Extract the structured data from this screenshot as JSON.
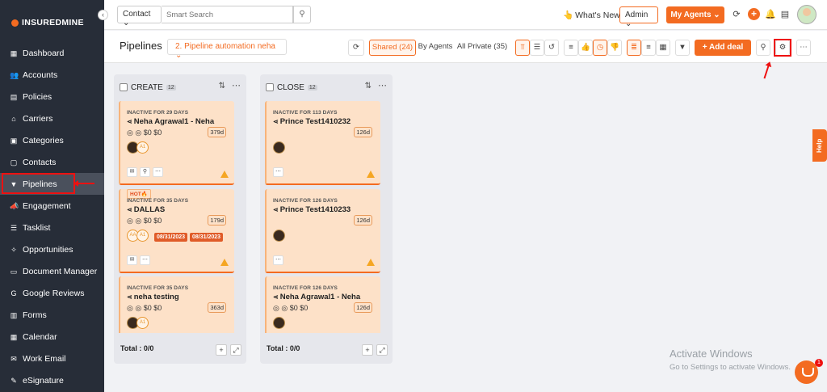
{
  "brand": {
    "name": "INSUREDMINE",
    "accent": "#f36b21",
    "sidebar_bg": "#272d38"
  },
  "sidebar": {
    "collapse_icon": "chevron-left-icon",
    "items": [
      {
        "label": "Dashboard",
        "icon": "dashboard-icon",
        "glyph": "▦"
      },
      {
        "label": "Accounts",
        "icon": "accounts-icon",
        "glyph": "👥"
      },
      {
        "label": "Policies",
        "icon": "policies-icon",
        "glyph": "▤"
      },
      {
        "label": "Carriers",
        "icon": "carriers-icon",
        "glyph": "⌂"
      },
      {
        "label": "Categories",
        "icon": "categories-icon",
        "glyph": "▣"
      },
      {
        "label": "Contacts",
        "icon": "contacts-icon",
        "glyph": "▢"
      },
      {
        "label": "Pipelines",
        "icon": "pipelines-icon",
        "glyph": "▼",
        "active": true
      },
      {
        "label": "Engagement",
        "icon": "engagement-icon",
        "glyph": "📣"
      },
      {
        "label": "Tasklist",
        "icon": "tasklist-icon",
        "glyph": "☰"
      },
      {
        "label": "Opportunities",
        "icon": "opportunities-icon",
        "glyph": "✧"
      },
      {
        "label": "Document Manager",
        "icon": "folder-icon",
        "glyph": "▭"
      },
      {
        "label": "Google Reviews",
        "icon": "google-icon",
        "glyph": "G"
      },
      {
        "label": "Forms",
        "icon": "forms-icon",
        "glyph": "▥"
      },
      {
        "label": "Calendar",
        "icon": "calendar-icon",
        "glyph": "▦"
      },
      {
        "label": "Work Email",
        "icon": "email-icon",
        "glyph": "✉"
      },
      {
        "label": "eSignature",
        "icon": "esignature-icon",
        "glyph": "✎"
      }
    ]
  },
  "topbar": {
    "contact_select": "Contact",
    "search_placeholder": "Smart Search",
    "whats_new": "What's New",
    "admin_select": "Admin",
    "my_agents": "My Agents"
  },
  "pipeline_header": {
    "title": "Pipelines",
    "pipeline_select": "2. Pipeline automation neha",
    "shared": "Shared (24)",
    "by_agents": "By Agents",
    "all_private": "All Private (35)",
    "add_deal": "+ Add deal"
  },
  "columns": [
    {
      "name": "CREATE",
      "count": "12",
      "total": "Total : 0/0",
      "cards": [
        {
          "inactive": "INACTIVE FOR 29 DAYS",
          "name": "Neha Agrawal1 - Neha",
          "amount": "$0 $0",
          "days": "379d",
          "avatars": [
            "A1"
          ],
          "hot": false,
          "dates": []
        },
        {
          "inactive": "INACTIVE FOR 35 DAYS",
          "name": "DALLAS",
          "amount": "$0 $0",
          "days": "179d",
          "avatars": [
            "AA",
            "A1"
          ],
          "hot": true,
          "hot_label": "HOT🔥",
          "dates": [
            "08/31/2023",
            "08/31/2023"
          ]
        },
        {
          "inactive": "INACTIVE FOR 35 DAYS",
          "name": "neha testing",
          "amount": "$0 $0",
          "days": "363d",
          "avatars": [
            "A1"
          ],
          "hot": false,
          "dates": []
        }
      ]
    },
    {
      "name": "CLOSE",
      "count": "12",
      "total": "Total : 0/0",
      "cards": [
        {
          "inactive": "INACTIVE FOR 113 DAYS",
          "name": "Prince Test1410232",
          "amount": "",
          "days": "126d",
          "avatars": [],
          "hot": false,
          "dates": []
        },
        {
          "inactive": "INACTIVE FOR 126 DAYS",
          "name": "Prince Test1410233",
          "amount": "",
          "days": "126d",
          "avatars": [],
          "hot": false,
          "dates": []
        },
        {
          "inactive": "INACTIVE FOR 126 DAYS",
          "name": "Neha Agrawal1 - Neha",
          "amount": "$0 $0",
          "days": "126d",
          "avatars": [],
          "hot": false,
          "dates": []
        }
      ]
    }
  ],
  "help": "Help",
  "watermark": {
    "line1": "Activate Windows",
    "line2": "Go to Settings to activate Windows."
  },
  "chat_badge": "1"
}
